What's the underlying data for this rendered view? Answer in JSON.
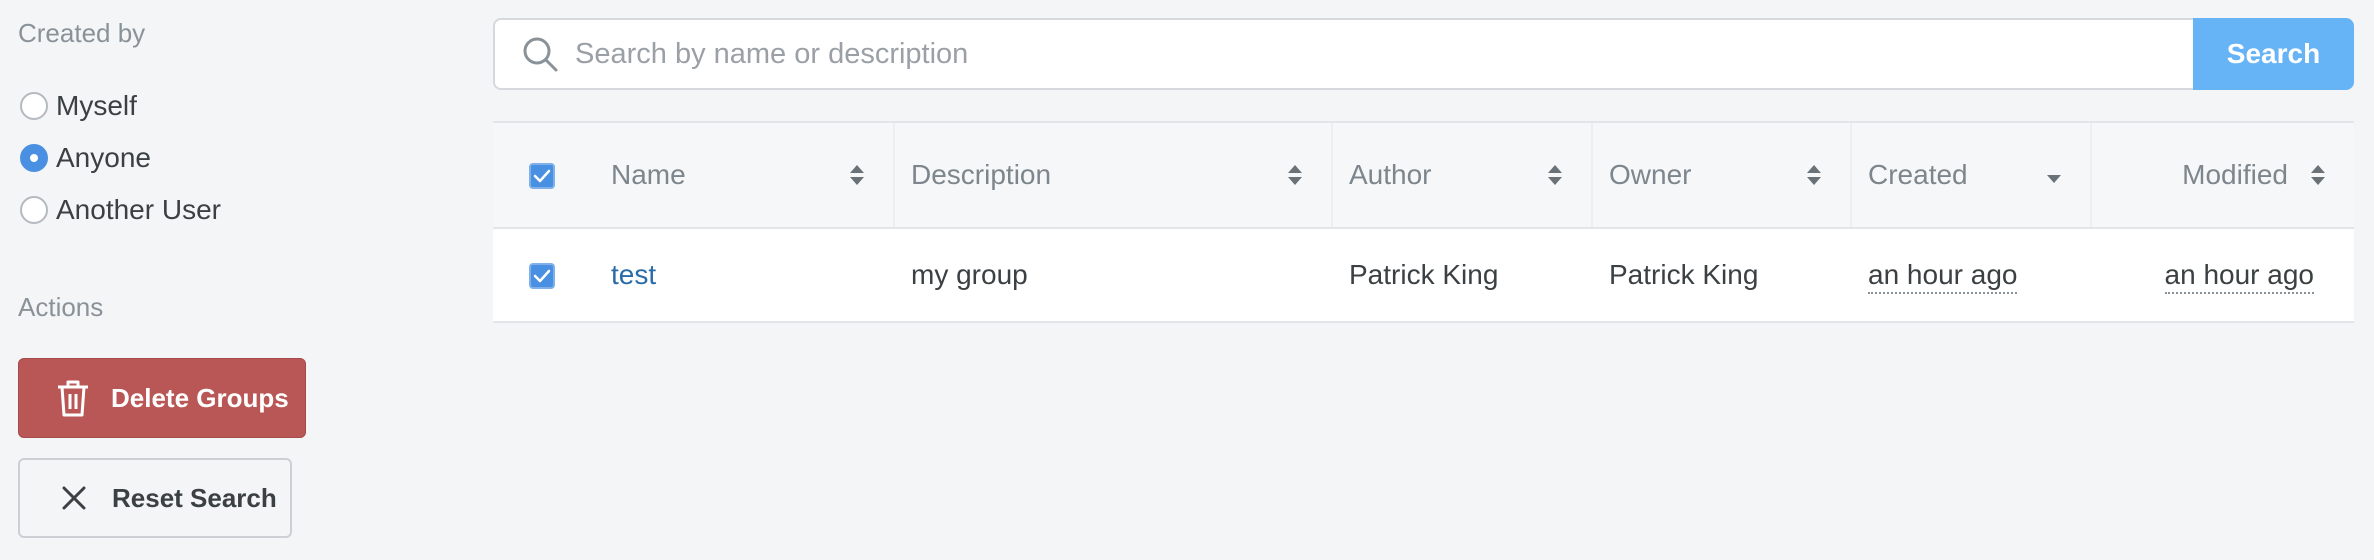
{
  "sidebar": {
    "created_by_title": "Created by",
    "radio_options": [
      {
        "label": "Myself",
        "checked": false
      },
      {
        "label": "Anyone",
        "checked": true
      },
      {
        "label": "Another User",
        "checked": false
      }
    ],
    "actions_title": "Actions",
    "delete_label": "Delete Groups",
    "reset_label": "Reset Search"
  },
  "search": {
    "placeholder": "Search by name or description",
    "value": "",
    "button_label": "Search"
  },
  "table": {
    "columns": [
      "Name",
      "Description",
      "Author",
      "Owner",
      "Created",
      "Modified"
    ],
    "rows": [
      {
        "selected": true,
        "name": "test",
        "description": "my group",
        "author": "Patrick King",
        "owner": "Patrick King",
        "created": "an hour ago",
        "modified": "an hour ago"
      }
    ]
  },
  "colors": {
    "accent": "#4a90e2",
    "danger": "#b85756",
    "search_button": "#66b3f5",
    "link": "#2a6ca8"
  }
}
